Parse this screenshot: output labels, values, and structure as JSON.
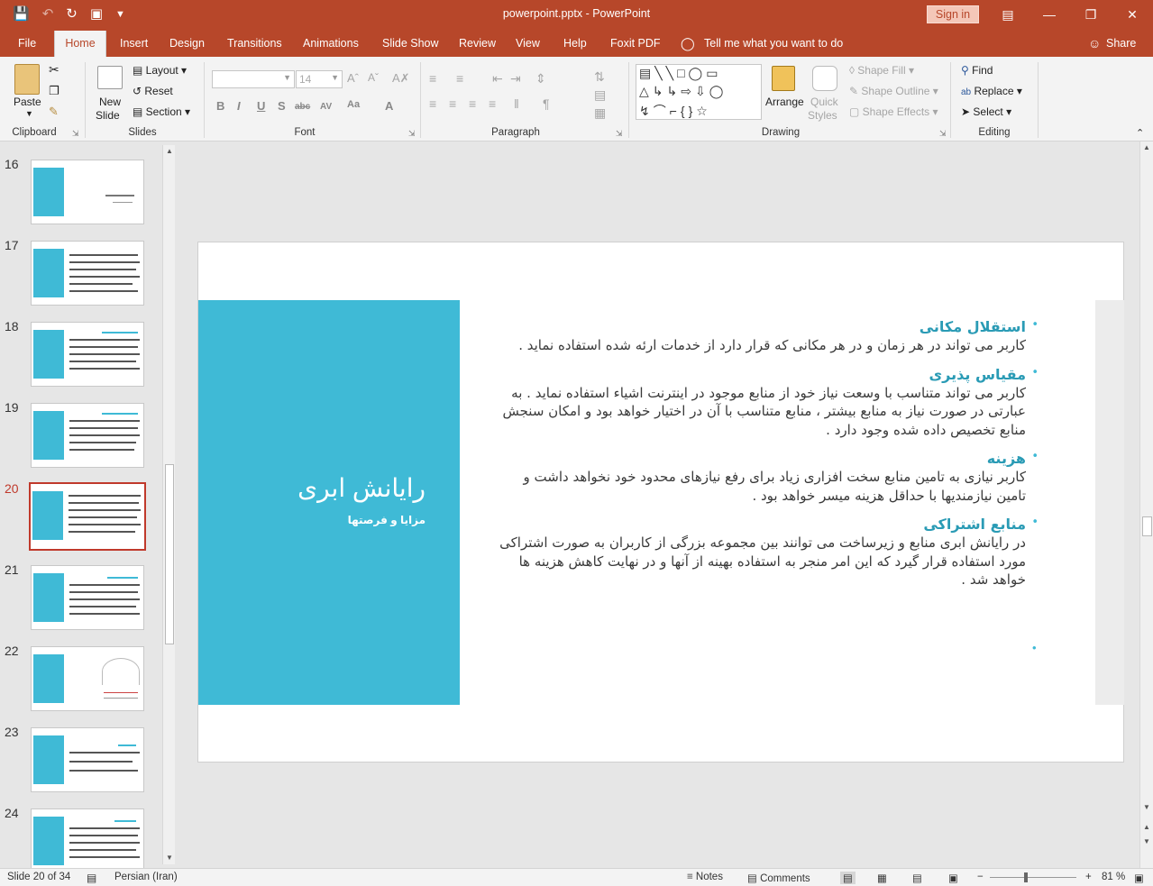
{
  "app": {
    "title": "powerpoint.pptx  -  PowerPoint",
    "signin_label": "Sign in"
  },
  "tabs": [
    {
      "label": "File"
    },
    {
      "label": "Home"
    },
    {
      "label": "Insert"
    },
    {
      "label": "Design"
    },
    {
      "label": "Transitions"
    },
    {
      "label": "Animations"
    },
    {
      "label": "Slide Show"
    },
    {
      "label": "Review"
    },
    {
      "label": "View"
    },
    {
      "label": "Help"
    },
    {
      "label": "Foxit PDF"
    },
    {
      "label": "Tell me what you want to do"
    },
    {
      "label": "Share"
    }
  ],
  "ribbon": {
    "clipboard": {
      "label": "Clipboard",
      "paste": "Paste"
    },
    "slides": {
      "label": "Slides",
      "new_slide_1": "New",
      "new_slide_2": "Slide",
      "layout": "Layout",
      "reset": "Reset",
      "section": "Section"
    },
    "font": {
      "label": "Font",
      "size": "14"
    },
    "paragraph": {
      "label": "Paragraph"
    },
    "drawing": {
      "label": "Drawing",
      "arrange": "Arrange",
      "quick_1": "Quick",
      "quick_2": "Styles",
      "shape_fill": "Shape Fill",
      "shape_outline": "Shape Outline",
      "shape_effects": "Shape Effects"
    },
    "editing": {
      "label": "Editing",
      "find": "Find",
      "replace": "Replace",
      "select": "Select"
    }
  },
  "slides_panel": [
    {
      "num": "16"
    },
    {
      "num": "17"
    },
    {
      "num": "18"
    },
    {
      "num": "19"
    },
    {
      "num": "20"
    },
    {
      "num": "21"
    },
    {
      "num": "22"
    },
    {
      "num": "23"
    },
    {
      "num": "24"
    }
  ],
  "current_slide": {
    "title": "رایانش ابری",
    "subtitle": "مزایا و فرصتها",
    "items": [
      {
        "head": "استقلال مکانی",
        "body": "کاربر می تواند در هر زمان و در هر مکانی که قرار دارد از خدمات ارئه شده استفاده نماید ."
      },
      {
        "head": "مقیاس پذیری",
        "body": "کاربر می تواند متناسب با وسعت نیاز خود از منابع موجود در اینترنت اشیاء استفاده نماید . به عبارتی در صورت نیاز به منابع بیشتر ، منابع متناسب با آن در اختیار خواهد بود و امکان سنجش منابع تخصیص داده شده وجود دارد ."
      },
      {
        "head": "هزینه",
        "body": "کاربر نیازی به تامین منابع سخت افزاری زیاد برای رفع نیازهای محدود خود نخواهد داشت و تامین نیازمندیها با حداقل هزینه میسر خواهد بود ."
      },
      {
        "head": "منابع اشتراکی",
        "body": "در رایانش ابری منابع و زیرساخت می توانند بین مجموعه بزرگی از کاربران به صورت اشتراکی مورد استفاده قرار گیرد که این امر منجر به استفاده بهینه از آنها و در نهایت کاهش هزینه ها خواهد شد ."
      }
    ]
  },
  "status": {
    "slide_counter": "Slide 20 of 34",
    "language": "Persian (Iran)",
    "notes": "Notes",
    "comments": "Comments",
    "zoom": "81 %"
  }
}
